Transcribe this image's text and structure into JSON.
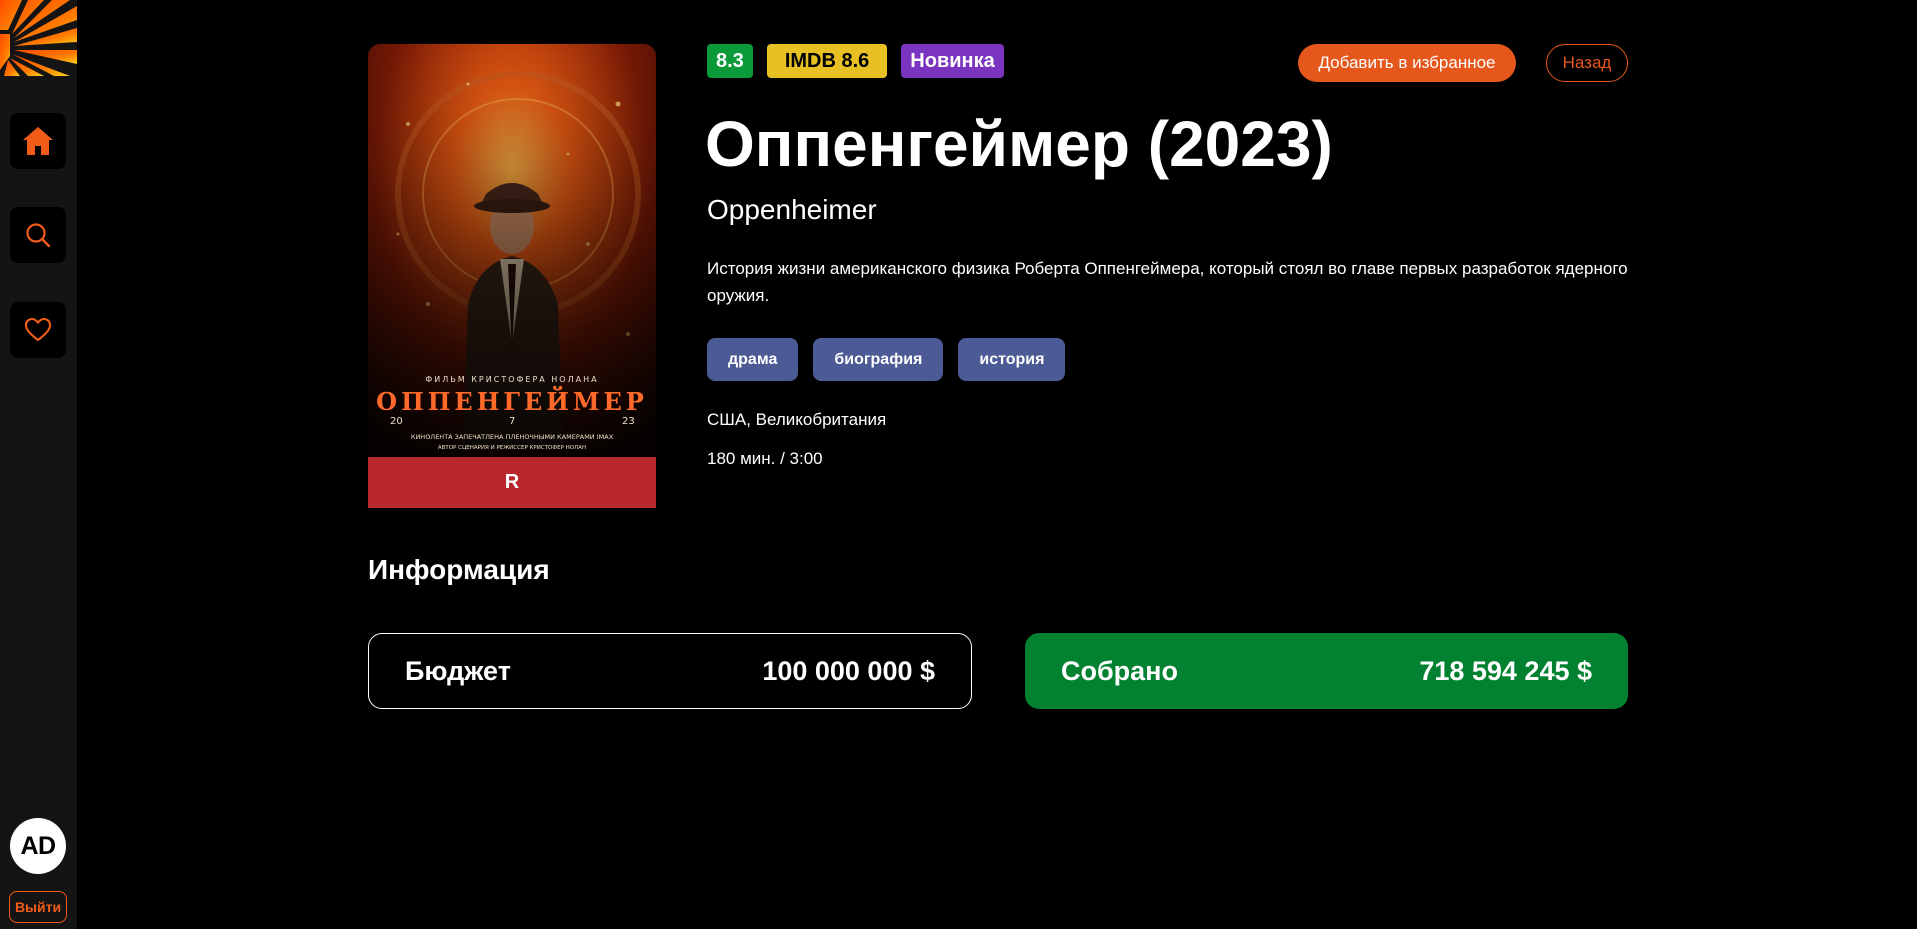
{
  "sidebar": {
    "nav": [
      {
        "name": "home",
        "icon": "home-icon",
        "active": true
      },
      {
        "name": "search",
        "icon": "search-icon",
        "active": false
      },
      {
        "name": "favorites",
        "icon": "heart-icon",
        "active": false
      }
    ],
    "avatar_initials": "AD",
    "logout_label": "Выйти"
  },
  "colors": {
    "accent": "#e5571a",
    "rating_badge": "#0b9a3a",
    "imdb_badge": "#e7c024",
    "new_badge": "#7a34c0",
    "genre_chip": "#4c5a95",
    "age_rating_bar": "#b8272b",
    "gross_card": "#028230"
  },
  "poster": {
    "title_text": "ОППЕНГЕЙМЕР",
    "age_rating": "R"
  },
  "badges": {
    "rating": "8.3",
    "imdb": "IMDB 8.6",
    "new": "Новинка"
  },
  "actions": {
    "favorite_label": "Добавить в избранное",
    "back_label": "Назад"
  },
  "movie": {
    "title": "Оппенгеймер (2023)",
    "original_title": "Oppenheimer",
    "description": "История жизни американского физика Роберта Оппенгеймера, который стоял во главе первых разработок ядерного оружия.",
    "genres": [
      "драма",
      "биография",
      "история"
    ],
    "countries": "США, Великобритания",
    "duration": "180 мин. / 3:00"
  },
  "info": {
    "heading": "Информация",
    "budget_label": "Бюджет",
    "budget_value": "100 000 000 $",
    "gross_label": "Собрано",
    "gross_value": "718 594 245 $"
  }
}
